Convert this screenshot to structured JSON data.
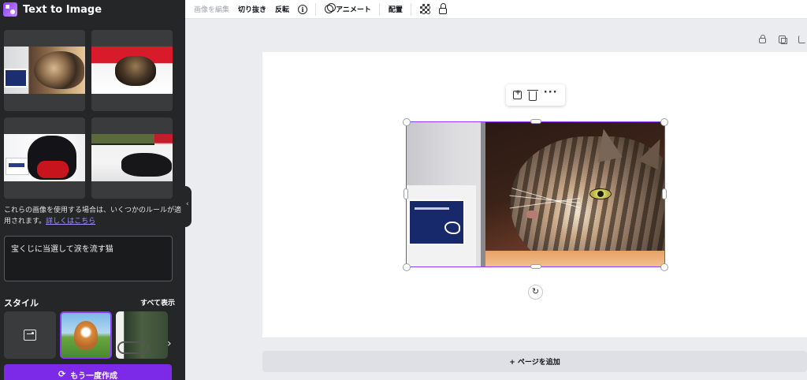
{
  "panel": {
    "title": "Text to Image",
    "results_alt": [
      "宝くじに当選して涙を流す猫 1",
      "宝くじに当選して涙を流す猫 2",
      "宝くじに当選して涙を流す猫 3",
      "宝くじに当選して涙を流す猫 4"
    ],
    "notice_text": "これらの画像を使用する場合は、いくつかのルールが適用されます。",
    "notice_link": "詳しくはこちら",
    "prompt_value": "宝くじに当選して涙を流す猫",
    "style_label": "スタイル",
    "show_all": "すべて表示",
    "regen_label": "もう一度作成"
  },
  "toolbar": {
    "edit_image": "画像を編集",
    "crop": "切り抜き",
    "flip": "反転",
    "info": "i",
    "animate": "アニメート",
    "position": "配置"
  },
  "canvas": {
    "add_page": "+ ページを追加",
    "rotate": "↻"
  },
  "colors": {
    "accent": "#8b3dff",
    "panel_bg": "#252627",
    "canvas_bg": "#ebecf0"
  }
}
